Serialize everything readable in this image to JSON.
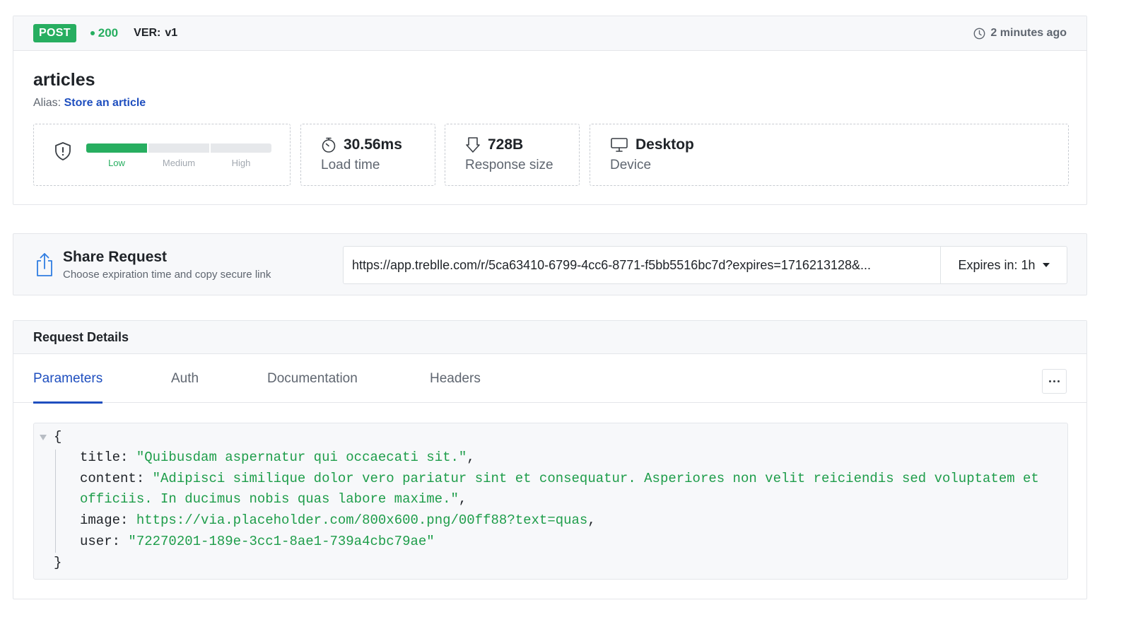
{
  "request": {
    "method": "POST",
    "status": "200",
    "version_label": "VER:",
    "version": "v1",
    "time_ago": "2 minutes ago",
    "endpoint": "articles",
    "alias_label": "Alias:",
    "alias": "Store an article"
  },
  "metrics": {
    "risk": {
      "levels": [
        "Low",
        "Medium",
        "High"
      ],
      "current": "Low"
    },
    "load_time": {
      "value": "30.56ms",
      "label": "Load time"
    },
    "response_size": {
      "value": "728B",
      "label": "Response size"
    },
    "device": {
      "value": "Desktop",
      "label": "Device"
    }
  },
  "share": {
    "title": "Share Request",
    "subtitle": "Choose expiration time and copy secure link",
    "url": "https://app.treblle.com/r/5ca63410-6799-4cc6-8771-f5bb5516bc7d?expires=1716213128&...",
    "expires_label": "Expires in: 1h"
  },
  "details": {
    "title": "Request Details",
    "tabs": [
      {
        "label": "Parameters",
        "active": true
      },
      {
        "label": "Auth",
        "active": false
      },
      {
        "label": "Documentation",
        "active": false
      },
      {
        "label": "Headers",
        "active": false
      }
    ],
    "json": {
      "open": "{",
      "close": "}",
      "title_key": "title:",
      "title_value": "\"Quibusdam aspernatur qui occaecati sit.\"",
      "content_key": "content:",
      "content_value_line1": "\"Adipisci similique dolor vero pariatur sint et consequatur. Asperiores non velit reiciendis sed voluptatem et",
      "content_value_line2": "officiis. In ducimus nobis quas labore maxime.\"",
      "image_key": "image:",
      "image_value": "https://via.placeholder.com/800x600.png/00ff88?text=quas",
      "user_key": "user:",
      "user_value": "\"72270201-189e-3cc1-8ae1-739a4cbc79ae\"",
      "comma": ","
    }
  },
  "colors": {
    "success": "#27ae60",
    "link": "#1f4fbf",
    "string": "#1e9d4a",
    "muted": "#5f6670"
  },
  "icons": {
    "time": "clock-icon",
    "risk": "shield-alert-icon",
    "load": "stopwatch-icon",
    "size": "download-icon",
    "device": "monitor-icon",
    "share": "share-icon",
    "more": "more-horizontal-icon",
    "collapse": "caret-down-icon"
  }
}
